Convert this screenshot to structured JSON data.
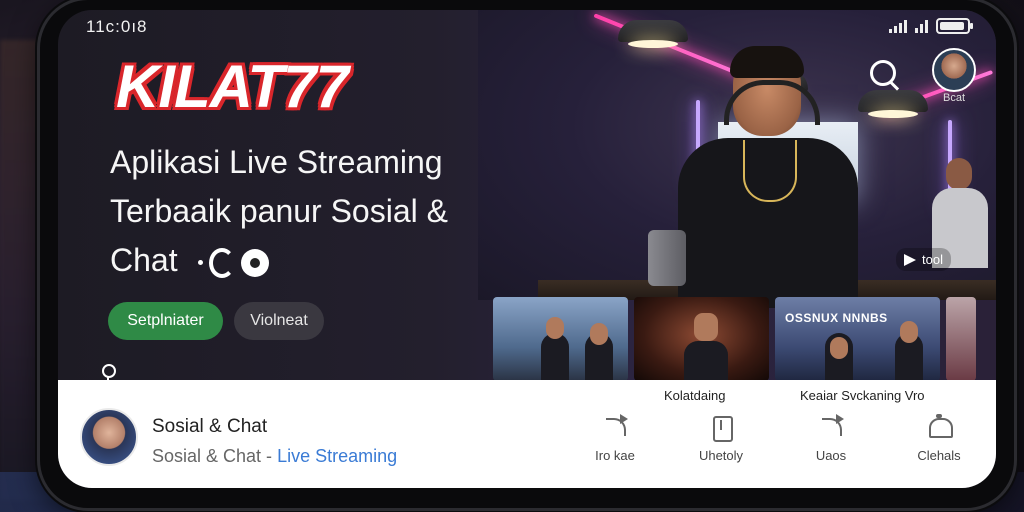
{
  "status_bar": {
    "time": "11c:0ı8"
  },
  "brand": {
    "logo_text": "KILAT77",
    "logo_color": "#d9262b"
  },
  "hero": {
    "headline_lines": [
      "Aplikasi Live Streaming",
      "Terbaaik panur Sosial &",
      "Chat"
    ],
    "primary_button": "Setplniater",
    "secondary_button": "Violneat",
    "primary_color": "#2f8a46"
  },
  "header_right": {
    "search_icon": "search-icon",
    "avatar_label": "Bcat"
  },
  "video": {
    "share_label": "tool"
  },
  "thumbnails": [
    {
      "id": "t1",
      "title": "",
      "caption": ""
    },
    {
      "id": "t2",
      "title": "",
      "caption": "Kolatdaing"
    },
    {
      "id": "t3",
      "title": "OSSNUX NNNBS",
      "caption": "Keaiar Svckaning Vro"
    },
    {
      "id": "t4",
      "title": "",
      "caption": ""
    }
  ],
  "card": {
    "title": "Sosial & Chat",
    "subtitle_prefix": "Sosial & Chat - ",
    "subtitle_accent": "Live Streaming",
    "accent_color": "#3a7bd5",
    "actions": [
      {
        "icon": "share-icon",
        "label": "Iro kae"
      },
      {
        "icon": "upload-icon",
        "label": "Uhetoly"
      },
      {
        "icon": "share-icon",
        "label": "Uaos"
      },
      {
        "icon": "bell-icon",
        "label": "Clehals"
      }
    ]
  }
}
